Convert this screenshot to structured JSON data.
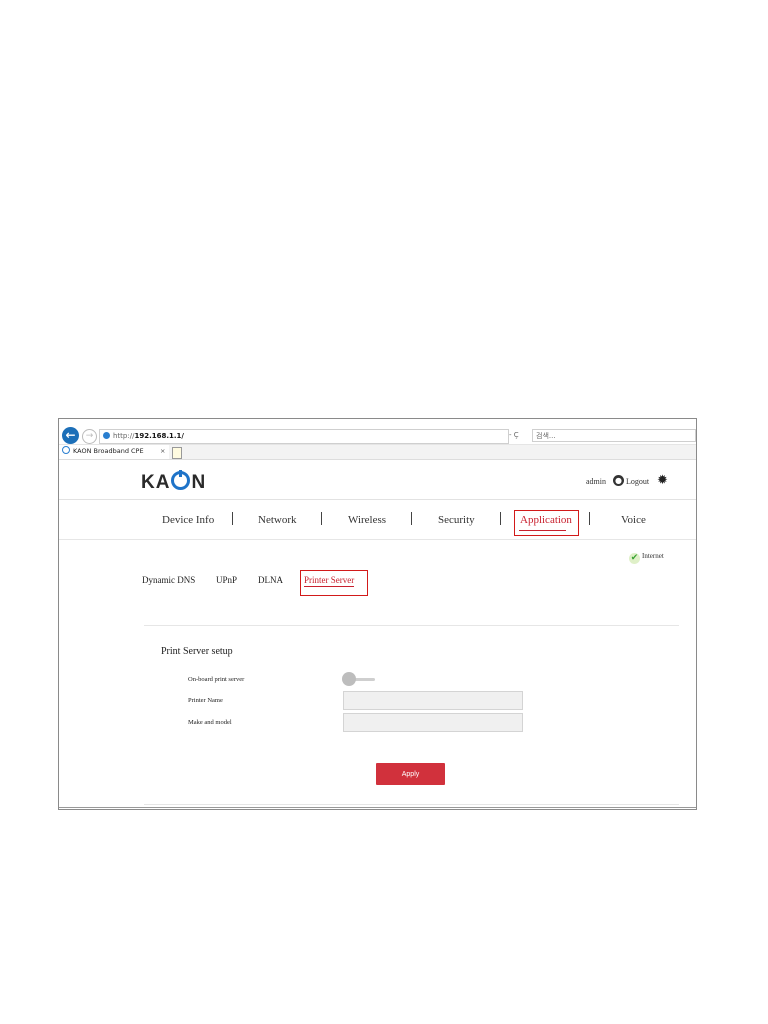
{
  "browser": {
    "url_prefix": "http://",
    "url_host": "192.168.1.1/",
    "url_tools": "- Ç",
    "search_placeholder": "검색...",
    "tab_title": "KAON Broadband CPE",
    "tab_close": "×"
  },
  "header": {
    "logo": "KAON",
    "user": "admin",
    "logout": "Logout"
  },
  "main_nav": [
    {
      "label": "Device Info"
    },
    {
      "label": "Network"
    },
    {
      "label": "Wireless"
    },
    {
      "label": "Security"
    },
    {
      "label": "Application",
      "active": true
    },
    {
      "label": "Voice"
    }
  ],
  "status": {
    "label": "Internet"
  },
  "sub_nav": [
    {
      "label": "Dynamic DNS"
    },
    {
      "label": "UPnP"
    },
    {
      "label": "DLNA"
    },
    {
      "label": "Printer Server",
      "active": true
    }
  ],
  "section": {
    "title": "Print Server setup",
    "onboard_label": "On-board print server",
    "onboard_enabled": false,
    "printer_name_label": "Printer Name",
    "printer_name_value": "",
    "make_model_label": "Make and model",
    "make_model_value": "",
    "apply_label": "Apply"
  },
  "colors": {
    "accent": "#c8202e",
    "apply_button": "#d1313c",
    "logo_blue": "#1e73c8",
    "highlight_box": "#d21a1a"
  }
}
